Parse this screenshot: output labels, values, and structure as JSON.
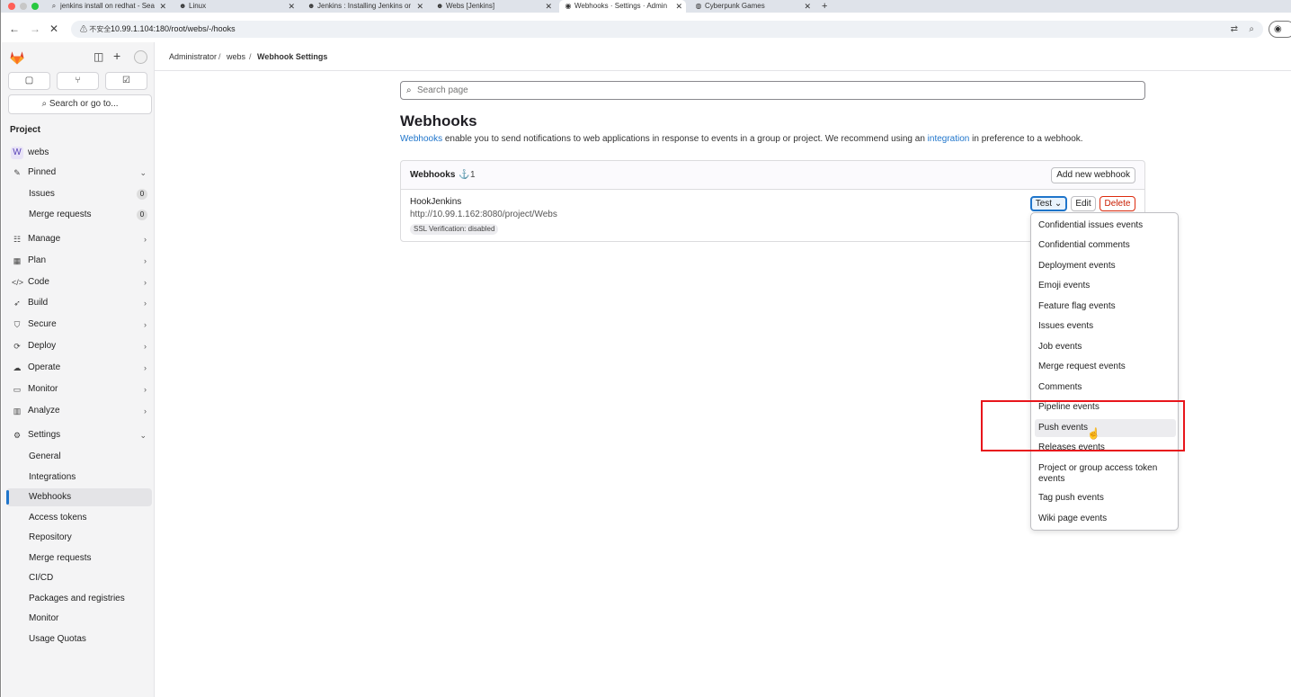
{
  "browser": {
    "tabs": [
      {
        "icon": "search-icon",
        "glyph": "⌕",
        "title": "jenkins install on redhat - Sea"
      },
      {
        "icon": "jenkins-icon",
        "glyph": "☻",
        "title": "Linux"
      },
      {
        "icon": "jenkins-icon",
        "glyph": "☻",
        "title": "Jenkins : Installing Jenkins or"
      },
      {
        "icon": "jenkins-icon",
        "glyph": "☻",
        "title": "Webs [Jenkins]"
      },
      {
        "icon": "gitlab-icon",
        "glyph": "◉",
        "title": "Webhooks · Settings · Admin"
      },
      {
        "icon": "globe-icon",
        "glyph": "◍",
        "title": "Cyberpunk Games"
      }
    ],
    "new_tab": "+",
    "insecure_label": "⚠ 不安全",
    "url": "10.99.1.104:180/root/webs/-/hooks"
  },
  "breadcrumb": {
    "items": [
      "Administrator",
      "webs",
      "Webhook Settings"
    ],
    "separator": "/"
  },
  "sidebar": {
    "search": "Search or go to...",
    "heading": "Project",
    "project": {
      "letter": "W",
      "name": "webs"
    },
    "pinned": {
      "label": "Pinned",
      "items": [
        {
          "label": "Issues",
          "count": "0"
        },
        {
          "label": "Merge requests",
          "count": "0"
        }
      ]
    },
    "nav": [
      {
        "label": "Manage",
        "icon": "users-icon"
      },
      {
        "label": "Plan",
        "icon": "calendar-icon"
      },
      {
        "label": "Code",
        "icon": "code-icon"
      },
      {
        "label": "Build",
        "icon": "rocket-icon"
      },
      {
        "label": "Secure",
        "icon": "shield-icon"
      },
      {
        "label": "Deploy",
        "icon": "deploy-icon"
      },
      {
        "label": "Operate",
        "icon": "cloud-icon"
      },
      {
        "label": "Monitor",
        "icon": "monitor-icon"
      },
      {
        "label": "Analyze",
        "icon": "chart-icon"
      }
    ],
    "settings": {
      "label": "Settings",
      "items": [
        "General",
        "Integrations",
        "Webhooks",
        "Access tokens",
        "Repository",
        "Merge requests",
        "CI/CD",
        "Packages and registries",
        "Monitor",
        "Usage Quotas"
      ],
      "active": "Webhooks"
    }
  },
  "main": {
    "search_placeholder": "Search page",
    "title": "Webhooks",
    "desc_link": "Webhooks",
    "desc_text_1": " enable you to send notifications to web applications in response to events in a group or project. We recommend using an ",
    "desc_link_2": "integration",
    "desc_text_2": " in preference to a webhook.",
    "card": {
      "title": "Webhooks",
      "count": "1",
      "add_button": "Add new webhook",
      "hook": {
        "name": "HookJenkins",
        "url": "http://10.99.1.162:8080/project/Webs",
        "ssl_badge": "SSL Verification: disabled"
      },
      "buttons": {
        "test": "Test",
        "edit": "Edit",
        "delete": "Delete"
      }
    },
    "test_menu": [
      "Confidential issues events",
      "Confidential comments",
      "Deployment events",
      "Emoji events",
      "Feature flag events",
      "Issues events",
      "Job events",
      "Merge request events",
      "Comments",
      "Pipeline events",
      "Push events",
      "Releases events",
      "Project or group access token events",
      "Tag push events",
      "Wiki page events"
    ],
    "hovered_item": "Push events"
  },
  "colors": {
    "accent": "#1f75cb",
    "danger": "#dd2b0e",
    "highlight_box": "#e8151b"
  }
}
